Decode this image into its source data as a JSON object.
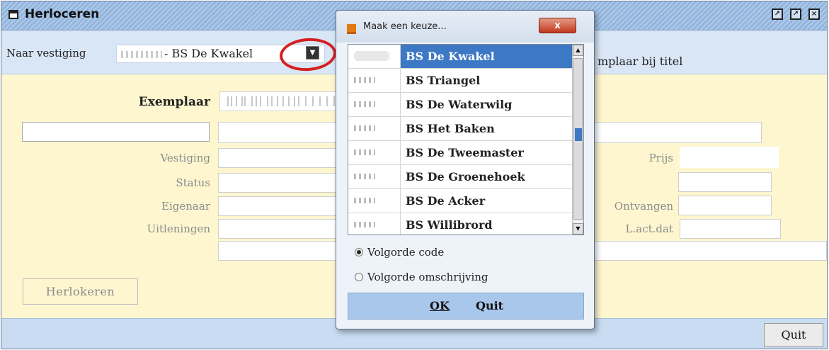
{
  "window": {
    "title": "Herloceren",
    "controls": [
      "restore-icon",
      "maximize-icon",
      "close-icon"
    ]
  },
  "toolbar": {
    "vestiging_label": "Naar vestiging",
    "vestiging_value": "- BS De Kwakel",
    "right_text": "mplaar bij titel"
  },
  "form": {
    "exemplaar_label": "Exemplaar",
    "labels": {
      "vestiging": "Vestiging",
      "status": "Status",
      "eigenaar": "Eigenaar",
      "uitleningen": "Uitleningen",
      "prijs": "Prijs",
      "ontvangen": "Ontvangen",
      "lactdat": "L.act.dat"
    },
    "herlokeren_button": "Herlokeren",
    "quit_button": "Quit"
  },
  "dialog": {
    "title": "Maak een keuze...",
    "close_label": "x",
    "items": [
      {
        "name": "BS De Kwakel",
        "selected": true
      },
      {
        "name": "BS Triangel",
        "selected": false
      },
      {
        "name": "BS De Waterwilg",
        "selected": false
      },
      {
        "name": "BS Het Baken",
        "selected": false
      },
      {
        "name": "BS De Tweemaster",
        "selected": false
      },
      {
        "name": "BS De Groenehoek",
        "selected": false
      },
      {
        "name": "BS De Acker",
        "selected": false
      },
      {
        "name": "BS Willibrord",
        "selected": false
      }
    ],
    "radio_code": "Volgorde code",
    "radio_omschrijving": "Volgorde omschrijving",
    "ok_label": "OK",
    "quit_label": "Quit"
  },
  "colors": {
    "selection": "#3c78c4",
    "form_background": "#fdf6cf",
    "highlight_circle": "#d62020"
  }
}
